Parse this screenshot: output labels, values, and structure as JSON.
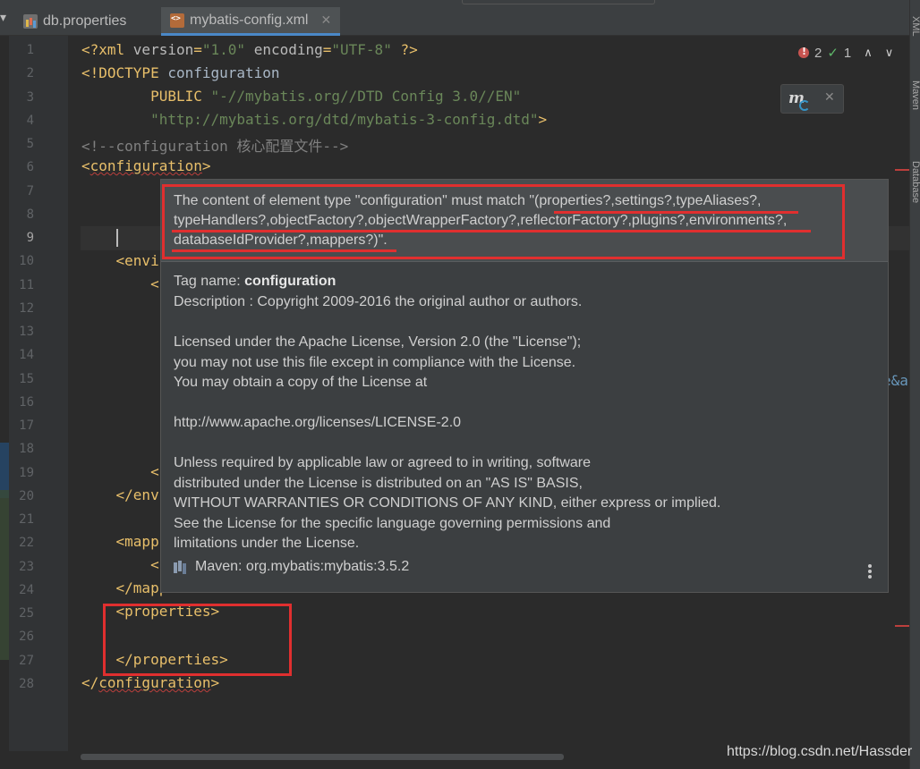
{
  "tabs": [
    {
      "label": "db.properties",
      "active": false
    },
    {
      "label": "mybatis-config.xml",
      "active": true
    }
  ],
  "inspection": {
    "errors": "2",
    "warnings": "1"
  },
  "code_lines": [
    "<?xml version=\"1.0\" encoding=\"UTF-8\" ?>",
    "<!DOCTYPE configuration",
    "        PUBLIC \"-//mybatis.org//DTD Config 3.0//EN\"",
    "        \"http://mybatis.org/dtd/mybatis-3-config.dtd\">",
    "<!--configuration 核心配置文件-->",
    "<configuration>",
    "",
    "",
    "",
    "    <envi",
    "        <",
    "",
    "",
    "",
    "",
    "",
    "",
    "",
    "        <",
    "    </envi",
    "",
    "    <mapp",
    "        <",
    "    </mappers>",
    "    <properties>",
    "",
    "    </properties>",
    "</configuration>"
  ],
  "line_numbers": [
    "1",
    "2",
    "3",
    "4",
    "5",
    "6",
    "7",
    "8",
    "9",
    "10",
    "11",
    "12",
    "13",
    "14",
    "15",
    "16",
    "17",
    "18",
    "19",
    "20",
    "21",
    "22",
    "23",
    "24",
    "25",
    "26",
    "27",
    "28"
  ],
  "code_fragment_right": "e&a",
  "tooltip": {
    "error_lines": [
      "The content of element type \"configuration\" must match \"(properties?,settings?,typeAliases?,",
      "typeHandlers?,objectFactory?,objectWrapperFactory?,reflectorFactory?,plugins?,environments?,",
      "databaseIdProvider?,mappers?)\"."
    ],
    "tag_name_label": "Tag name: ",
    "tag_name": "configuration",
    "description_lines": [
      "Description : Copyright 2009-2016 the original author or authors.",
      "",
      "Licensed under the Apache License, Version 2.0 (the \"License\");",
      "you may not use this file except in compliance with the License.",
      "You may obtain a copy of the License at",
      "",
      "http://www.apache.org/licenses/LICENSE-2.0",
      "",
      "Unless required by applicable law or agreed to in writing, software",
      "distributed under the License is distributed on an \"AS IS\" BASIS,",
      "WITHOUT WARRANTIES OR CONDITIONS OF ANY KIND, either express or implied.",
      "See the License for the specific language governing permissions and",
      "limitations under the License."
    ],
    "maven_label": "Maven: org.mybatis:mybatis:3.5.2"
  },
  "right_sidebar": [
    "XML",
    "Maven",
    "Database"
  ],
  "watermark": "https://blog.csdn.net/Hassder",
  "icons": [
    "properties-file-icon",
    "xml-file-icon",
    "error-icon",
    "check-icon",
    "maven-icon",
    "library-icon",
    "more-icon"
  ],
  "colors": {
    "error_red": "#e02f2f",
    "tag": "#e8bf6a",
    "string": "#6a8759",
    "comment": "#808080"
  }
}
